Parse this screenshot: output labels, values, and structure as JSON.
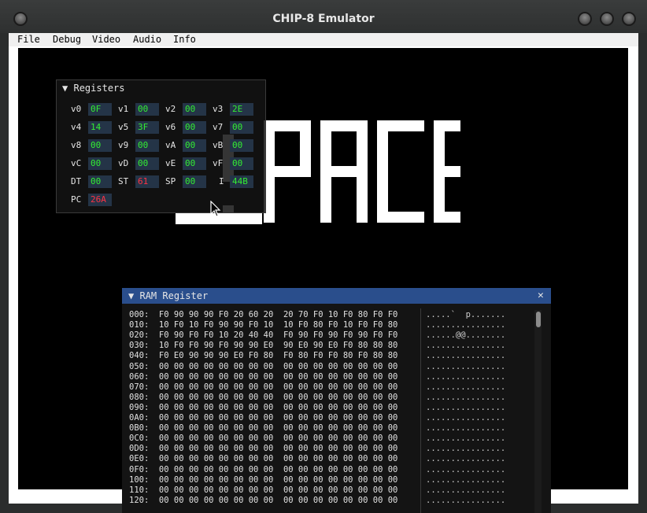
{
  "window": {
    "title": "CHIP-8 Emulator"
  },
  "menu": [
    "File",
    "Debug",
    "Video",
    "Audio",
    "Info"
  ],
  "registers_panel": {
    "title": "Registers",
    "collapse_icon": "triangle-down-icon",
    "rows": [
      [
        {
          "label": "v0",
          "value": "0F",
          "color": "green"
        },
        {
          "label": "v1",
          "value": "00",
          "color": "green"
        },
        {
          "label": "v2",
          "value": "00",
          "color": "green"
        },
        {
          "label": "v3",
          "value": "2E",
          "color": "green"
        }
      ],
      [
        {
          "label": "v4",
          "value": "14",
          "color": "green"
        },
        {
          "label": "v5",
          "value": "3F",
          "color": "green"
        },
        {
          "label": "v6",
          "value": "00",
          "color": "green"
        },
        {
          "label": "v7",
          "value": "00",
          "color": "green"
        }
      ],
      [
        {
          "label": "v8",
          "value": "00",
          "color": "green"
        },
        {
          "label": "v9",
          "value": "00",
          "color": "green"
        },
        {
          "label": "vA",
          "value": "00",
          "color": "green"
        },
        {
          "label": "vB",
          "value": "00",
          "color": "green"
        }
      ],
      [
        {
          "label": "vC",
          "value": "00",
          "color": "green"
        },
        {
          "label": "vD",
          "value": "00",
          "color": "green"
        },
        {
          "label": "vE",
          "value": "00",
          "color": "green"
        },
        {
          "label": "vF",
          "value": "00",
          "color": "green"
        }
      ],
      [
        {
          "label": "DT",
          "value": "00",
          "color": "green"
        },
        {
          "label": "ST",
          "value": "61",
          "color": "red"
        },
        {
          "label": "SP",
          "value": "00",
          "color": "green"
        },
        {
          "label": "I",
          "value": "44B",
          "color": "green"
        }
      ],
      [
        {
          "label": "PC",
          "value": "26A",
          "color": "red"
        }
      ]
    ]
  },
  "ram_panel": {
    "title": "RAM Register",
    "close_icon": "close-icon",
    "lines": [
      "000:  F0 90 90 90 F0 20 60 20  20 70 F0 10 F0 80 F0 F0",
      "010:  10 F0 10 F0 90 90 F0 10  10 F0 80 F0 10 F0 F0 80",
      "020:  F0 90 F0 F0 10 20 40 40  F0 90 F0 90 F0 90 F0 F0",
      "030:  10 F0 F0 90 F0 90 90 E0  90 E0 90 E0 F0 80 80 80",
      "040:  F0 E0 90 90 90 E0 F0 80  F0 80 F0 F0 80 F0 80 80",
      "050:  00 00 00 00 00 00 00 00  00 00 00 00 00 00 00 00",
      "060:  00 00 00 00 00 00 00 00  00 00 00 00 00 00 00 00",
      "070:  00 00 00 00 00 00 00 00  00 00 00 00 00 00 00 00",
      "080:  00 00 00 00 00 00 00 00  00 00 00 00 00 00 00 00",
      "090:  00 00 00 00 00 00 00 00  00 00 00 00 00 00 00 00",
      "0A0:  00 00 00 00 00 00 00 00  00 00 00 00 00 00 00 00",
      "0B0:  00 00 00 00 00 00 00 00  00 00 00 00 00 00 00 00",
      "0C0:  00 00 00 00 00 00 00 00  00 00 00 00 00 00 00 00",
      "0D0:  00 00 00 00 00 00 00 00  00 00 00 00 00 00 00 00",
      "0E0:  00 00 00 00 00 00 00 00  00 00 00 00 00 00 00 00",
      "0F0:  00 00 00 00 00 00 00 00  00 00 00 00 00 00 00 00",
      "100:  00 00 00 00 00 00 00 00  00 00 00 00 00 00 00 00",
      "110:  00 00 00 00 00 00 00 00  00 00 00 00 00 00 00 00",
      "120:  00 00 00 00 00 00 00 00  00 00 00 00 00 00 00 00"
    ],
    "ascii": [
      ".....`  p.......",
      "................",
      "......@@........",
      "................",
      "................",
      "................",
      "................",
      "................",
      "................",
      "................",
      "................",
      "................",
      "................",
      "................",
      "................",
      "................",
      "................",
      "................",
      "................"
    ]
  },
  "colors": {
    "value_green": "#33ee33",
    "value_red": "#ff3344",
    "header_blue": "#2a4e8c"
  }
}
